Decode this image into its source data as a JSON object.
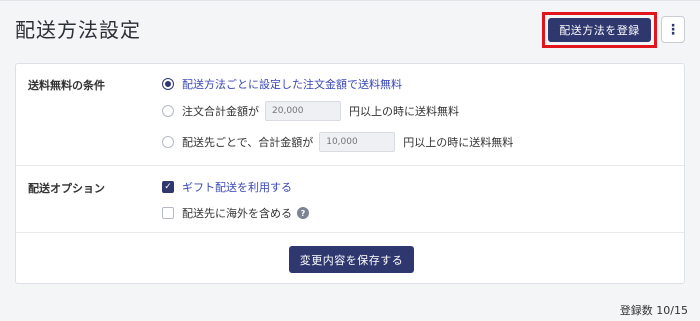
{
  "header": {
    "title": "配送方法設定",
    "register_button": "配送方法を登録",
    "more_button": "⋮"
  },
  "free_shipping": {
    "label": "送料無料の条件",
    "options": [
      {
        "label": "配送方法ごとに設定した注文金額で送料無料",
        "selected": true
      },
      {
        "prefix": "注文合計金額が",
        "input_placeholder": "20,000",
        "suffix": "円以上の時に送料無料",
        "selected": false
      },
      {
        "prefix": "配送先ごとで、合計金額が",
        "input_placeholder": "10,000",
        "suffix": "円以上の時に送料無料",
        "selected": false
      }
    ]
  },
  "shipping_options": {
    "label": "配送オプション",
    "items": [
      {
        "label": "ギフト配送を利用する",
        "checked": true
      },
      {
        "label": "配送先に海外を含める",
        "checked": false,
        "help": "?"
      }
    ]
  },
  "save_button": "変更内容を保存する",
  "registration_count": "登録数 10/15",
  "colors": {
    "primary": "#2f376f",
    "accent_text": "#3a47b5",
    "highlight_border": "#e0161c"
  }
}
